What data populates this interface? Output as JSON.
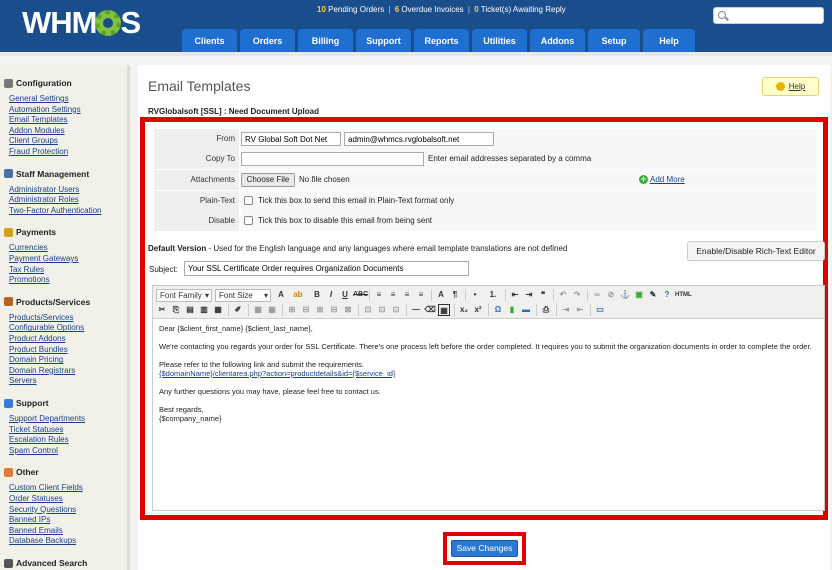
{
  "app": {
    "logo_text_left": "WHM",
    "logo_text_right": "S"
  },
  "header": {
    "alerts": {
      "pending_orders_count": "10",
      "pending_orders_label": "Pending Orders",
      "overdue_invoices_count": "6",
      "overdue_invoices_label": "Overdue Invoices",
      "tickets_count": "0",
      "tickets_label": "Ticket(s) Awaiting Reply",
      "separator": "|"
    },
    "search": {
      "placeholder": "",
      "value": ""
    }
  },
  "nav": {
    "tabs": [
      "Clients",
      "Orders",
      "Billing",
      "Support",
      "Reports",
      "Utilities",
      "Addons",
      "Setup",
      "Help"
    ]
  },
  "sidebar": {
    "sections": [
      {
        "title": "Configuration",
        "icon": "wrench-icon",
        "color": "#777777",
        "links": [
          "General Settings",
          "Automation Settings",
          "Email Templates",
          "Addon Modules",
          "Client Groups",
          "Fraud Protection"
        ]
      },
      {
        "title": "Staff Management",
        "icon": "user-icon",
        "color": "#4a6fa5",
        "links": [
          "Administrator Users",
          "Administrator Roles",
          "Two-Factor Authentication"
        ]
      },
      {
        "title": "Payments",
        "icon": "money-icon",
        "color": "#d4a017",
        "links": [
          "Currencies",
          "Payment Gateways",
          "Tax Rules",
          "Promotions"
        ]
      },
      {
        "title": "Products/Services",
        "icon": "box-icon",
        "color": "#b5651d",
        "links": [
          "Products/Services",
          "Configurable Options",
          "Product Addons",
          "Product Bundles",
          "Domain Pricing",
          "Domain Registrars",
          "Servers"
        ]
      },
      {
        "title": "Support",
        "icon": "support-icon",
        "color": "#3a7bd5",
        "links": [
          "Support Departments",
          "Ticket Statuses",
          "Escalation Rules",
          "Spam Control"
        ]
      },
      {
        "title": "Other",
        "icon": "tools-icon",
        "color": "#e07b39",
        "links": [
          "Custom Client Fields",
          "Order Statuses",
          "Security Questions",
          "Banned IPs",
          "Banned Emails",
          "Database Backups"
        ]
      },
      {
        "title": "Advanced Search",
        "icon": "magnifier-icon",
        "color": "#555555",
        "links": []
      }
    ]
  },
  "main": {
    "page_title": "Email Templates",
    "help_label": "Help",
    "template_name": "RVGlobalsoft [SSL] : Need Document Upload",
    "form": {
      "from_label": "From",
      "from_name": "RV Global Soft Dot Net",
      "from_email": "admin@whmcs.rvglobalsoft.net",
      "copy_to_label": "Copy To",
      "copy_to_value": "",
      "copy_to_note": "Enter email addresses separated by a comma",
      "attachments_label": "Attachments",
      "choose_file_label": "Choose File",
      "no_file_label": "No file chosen",
      "add_more_label": "Add More",
      "plain_text_label": "Plain-Text",
      "plain_text_note": "Tick this box to send this email in Plain-Text format only",
      "disable_label": "Disable",
      "disable_note": "Tick this box to disable this email from being sent"
    },
    "default_version_title": "Default Version",
    "default_version_note": " - Used for the English language and any languages where email template translations are not defined",
    "rte_toggle_label": "Enable/Disable Rich-Text Editor",
    "subject_label": "Subject:",
    "subject_value": "Your SSL Certificate Order requires Organization Documents",
    "editor": {
      "font_family_label": "Font Family",
      "font_size_label": "Font Size",
      "body": {
        "greeting": "Dear {$client_first_name} {$client_last_name},",
        "para1": "We're contacting you regards your order for SSL Certificate. There's one process left before the order completed. It requires you to submit the organization documents in order to complete the order.",
        "para2": "Please refer to the following link and submit the requirements.",
        "link": "{$domainName}/clientarea.php?action=productdetails&id={$service_id}",
        "para3": "Any further questions you may have, please feel free to contact us.",
        "closing": "Best regards,",
        "signature": "{$company_name}"
      }
    },
    "save_label": "Save Changes"
  }
}
